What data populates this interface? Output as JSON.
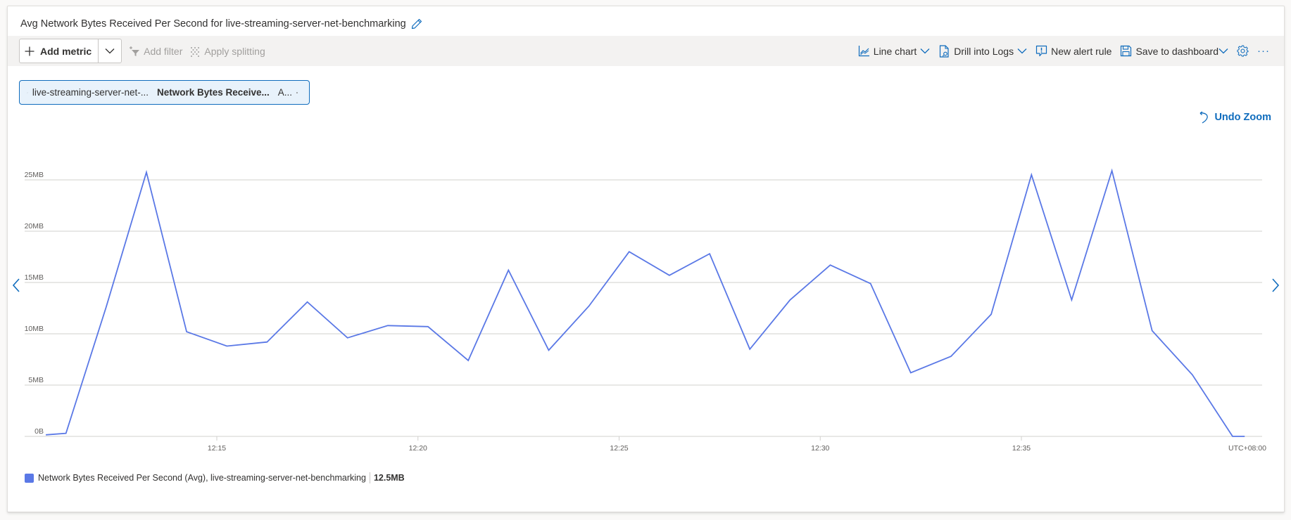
{
  "header": {
    "title": "Avg Network Bytes Received Per Second for live-streaming-server-net-benchmarking",
    "edit_icon": "pencil-icon"
  },
  "toolbar": {
    "add_metric_label": "Add metric",
    "add_filter_label": "Add filter",
    "apply_splitting_label": "Apply splitting",
    "line_chart_label": "Line chart",
    "drill_logs_label": "Drill into Logs",
    "new_alert_label": "New alert rule",
    "save_dashboard_label": "Save to dashboard",
    "settings_icon": "gear-icon",
    "more_label": "···"
  },
  "metric_pill": {
    "resource": "live-streaming-server-net-...",
    "metric": "Network Bytes Receive...",
    "aggregation": "A..."
  },
  "undo_zoom_label": "Undo Zoom",
  "colors": {
    "series": "#5a78e6",
    "accent": "#0f6cbd",
    "grid": "#d2d0ce"
  },
  "legend": {
    "label": "Network Bytes Received Per Second (Avg), live-streaming-server-net-benchmarking",
    "value": "12.5MB"
  },
  "chart_data": {
    "type": "line",
    "title": "Avg Network Bytes Received Per Second for live-streaming-server-net-benchmarking",
    "xlabel": "",
    "ylabel": "",
    "x_unit": "minutes after 12:00 (UTC+08:00)",
    "timezone_label": "UTC+08:00",
    "x_range": [
      10.35,
      41.3
    ],
    "x_ticks": [
      {
        "value": 15,
        "label": "12:15"
      },
      {
        "value": 20,
        "label": "12:20"
      },
      {
        "value": 25,
        "label": "12:25"
      },
      {
        "value": 30,
        "label": "12:30"
      },
      {
        "value": 35,
        "label": "12:35"
      }
    ],
    "ylim": [
      0,
      25
    ],
    "y_ticks": [
      {
        "value": 0,
        "label": "0B"
      },
      {
        "value": 5,
        "label": "5MB"
      },
      {
        "value": 10,
        "label": "10MB"
      },
      {
        "value": 15,
        "label": "15MB"
      },
      {
        "value": 20,
        "label": "20MB"
      },
      {
        "value": 25,
        "label": "25MB"
      }
    ],
    "grid": true,
    "legend_position": "bottom-left",
    "series": [
      {
        "name": "Network Bytes Received Per Second (Avg), live-streaming-server-net-benchmarking",
        "unit": "MB",
        "x": [
          10.75,
          11.25,
          12.25,
          13.25,
          14.25,
          15.25,
          16.25,
          17.25,
          18.25,
          19.25,
          20.25,
          21.25,
          22.25,
          23.25,
          24.25,
          25.25,
          26.25,
          27.25,
          28.25,
          29.25,
          30.25,
          31.25,
          32.25,
          33.25,
          34.25,
          35.25,
          36.25,
          37.25,
          38.25,
          39.25,
          40.25,
          40.55
        ],
        "values": [
          0.15,
          0.3,
          12.6,
          25.75,
          10.2,
          8.8,
          9.2,
          13.1,
          9.6,
          10.8,
          10.7,
          7.4,
          16.2,
          8.4,
          12.7,
          18.0,
          15.7,
          17.8,
          8.5,
          13.3,
          16.7,
          14.9,
          6.2,
          7.8,
          11.9,
          25.5,
          13.3,
          25.9,
          10.3,
          6.0,
          0.0,
          0.0
        ]
      }
    ]
  }
}
